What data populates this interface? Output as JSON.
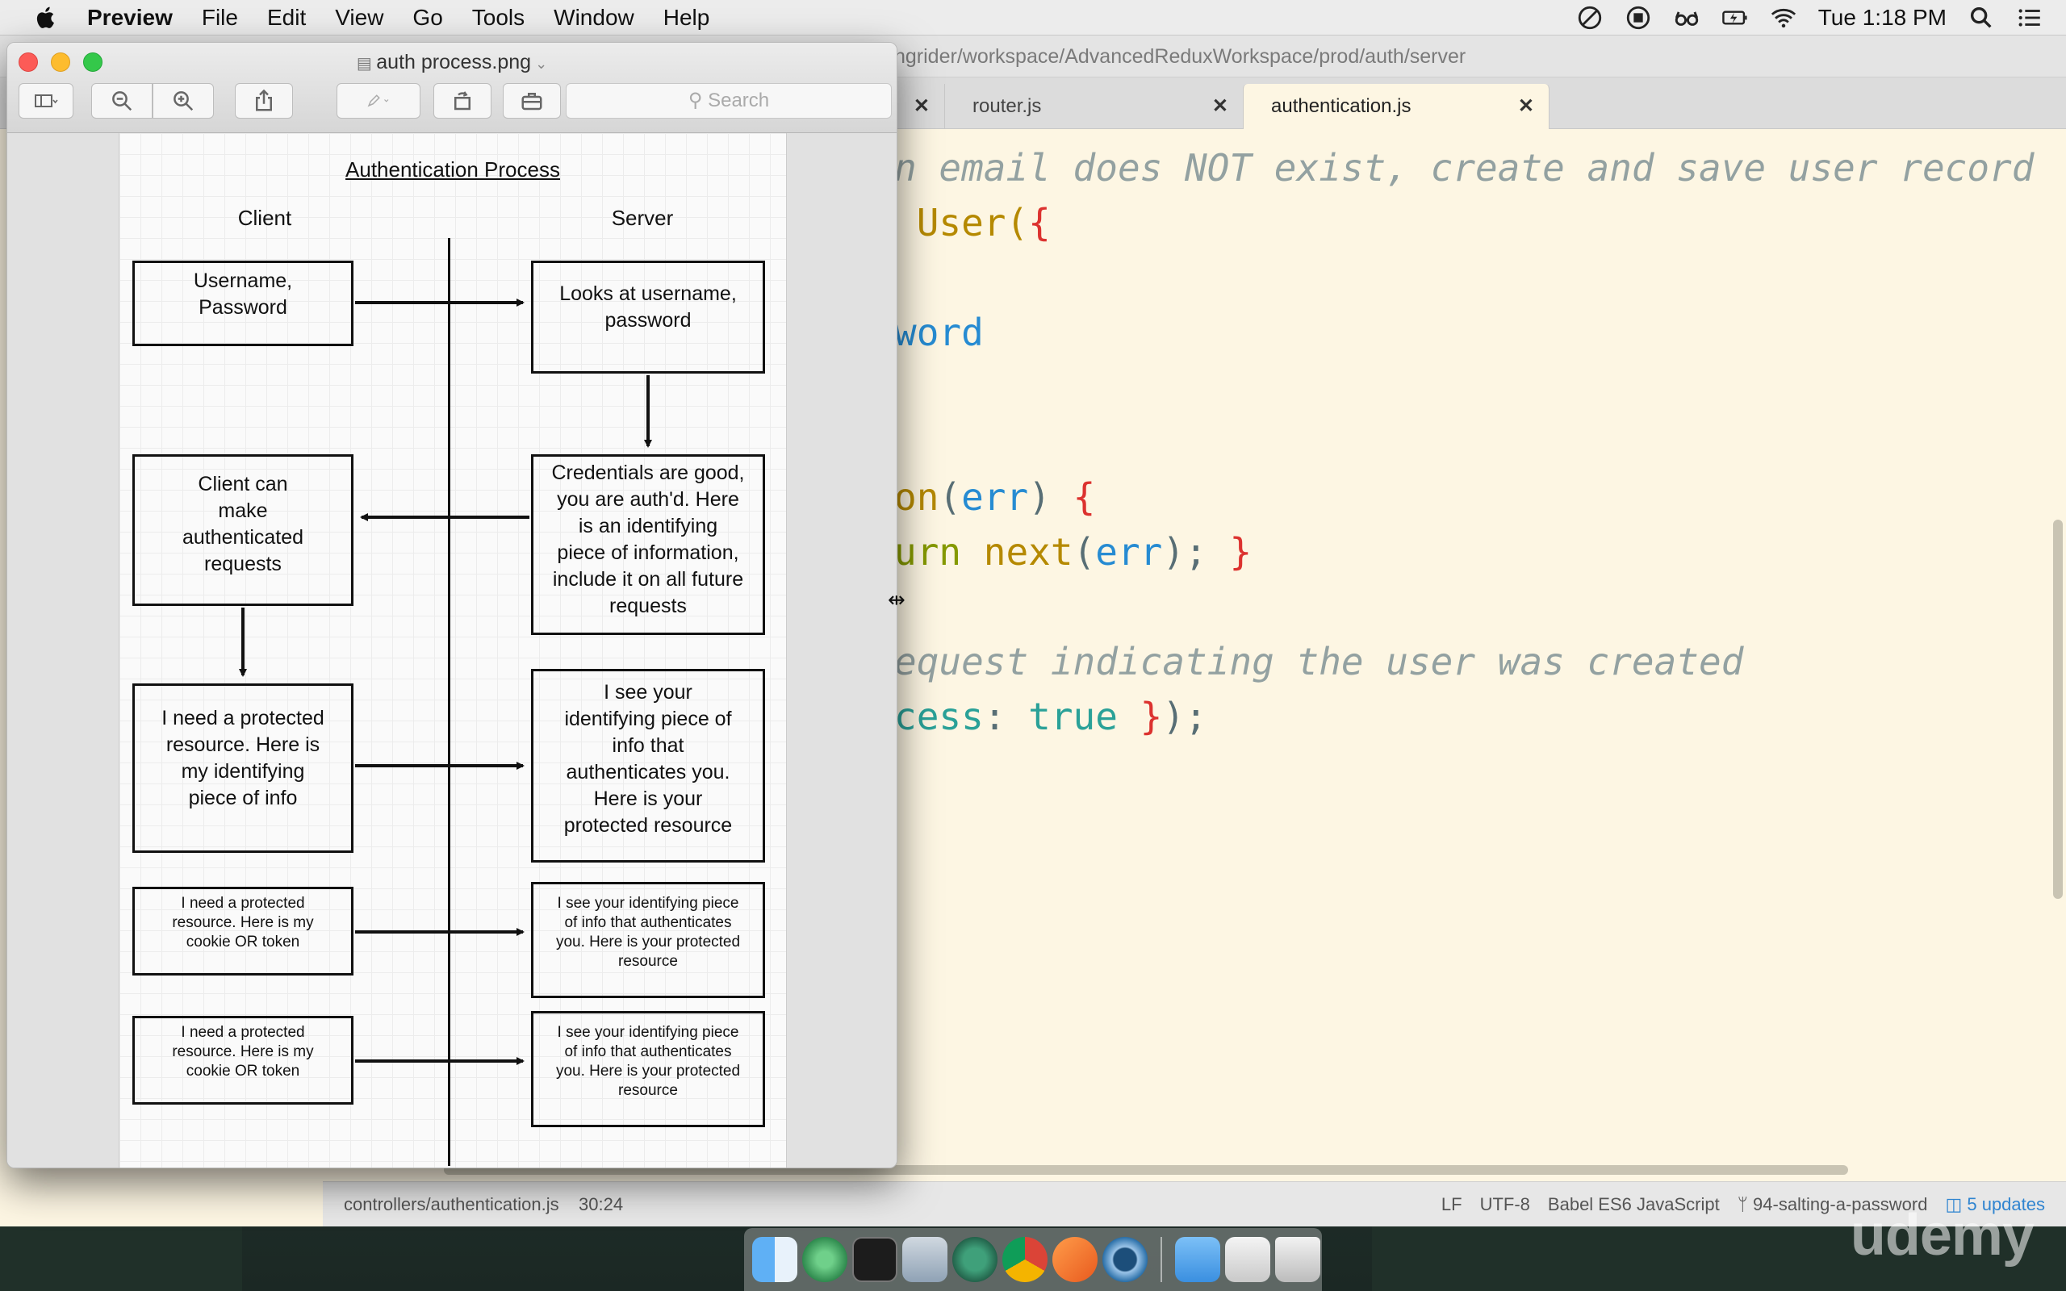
{
  "menubar": {
    "app_name": "Preview",
    "items": [
      "File",
      "Edit",
      "View",
      "Go",
      "Tools",
      "Window",
      "Help"
    ],
    "clock": "Tue 1:18 PM"
  },
  "editor": {
    "path": "ngrider/workspace/AdvancedReduxWorkspace/prod/auth/server",
    "tabs": [
      {
        "label": ""
      },
      {
        "label": "router.js"
      },
      {
        "label": "authentication.js"
      }
    ],
    "code_lines": [
      [
        {
          "t": "n email does NOT exist, create and save user record",
          "c": "comment"
        }
      ],
      [
        {
          "t": " User(",
          "c": "yellow"
        },
        {
          "t": "{",
          "c": "red"
        }
      ],
      [],
      [
        {
          "t": "word",
          "c": "blue"
        }
      ],
      [],
      [],
      [
        {
          "t": "on",
          "c": "yellow"
        },
        {
          "t": "(",
          "c": "grey"
        },
        {
          "t": "err",
          "c": "blue"
        },
        {
          "t": ") ",
          "c": "grey"
        },
        {
          "t": "{",
          "c": "red"
        }
      ],
      [
        {
          "t": "urn ",
          "c": "green"
        },
        {
          "t": "next",
          "c": "yellow"
        },
        {
          "t": "(",
          "c": "grey"
        },
        {
          "t": "err",
          "c": "blue"
        },
        {
          "t": "); ",
          "c": "grey"
        },
        {
          "t": "}",
          "c": "red"
        }
      ],
      [],
      [
        {
          "t": "equest indicating the user was created",
          "c": "comment"
        }
      ],
      [
        {
          "t": "cess",
          "c": "cyan"
        },
        {
          "t": ": ",
          "c": "grey"
        },
        {
          "t": "true",
          "c": "cyan"
        },
        {
          "t": " }",
          "c": "red"
        },
        {
          "t": ");",
          "c": "grey"
        }
      ]
    ],
    "status": {
      "file": "controllers/authentication.js",
      "cursor": "30:24",
      "line_ending": "LF",
      "encoding": "UTF-8",
      "grammar": "Babel ES6 JavaScript",
      "branch": "94-salting-a-password",
      "updates": "5 updates"
    }
  },
  "preview": {
    "title": "auth process.png",
    "search_placeholder": "Search",
    "diagram": {
      "title": "Authentication Process",
      "client_label": "Client",
      "server_label": "Server",
      "boxes": {
        "c1": "Username,\nPassword",
        "s1": "Looks at username,\npassword",
        "s2": "Credentials are good,\nyou are auth'd.  Here\nis an identifying\npiece of information,\ninclude it on all future\nrequests",
        "c2": "Client can\nmake\nauthenticated\nrequests",
        "c3": "I need a protected\nresource.  Here is\nmy identifying\npiece of info",
        "s3": "I see your\nidentifying piece of\ninfo that\nauthenticates you.\nHere is your\nprotected resource",
        "c4": "I need a protected\nresource.  Here is my\ncookie OR token",
        "s4": "I see your identifying piece\nof info that authenticates\nyou.  Here is your protected\nresource",
        "c5": "I need a protected\nresource.  Here is my\ncookie OR token",
        "s5": "I see your identifying piece\nof info that authenticates\nyou.  Here is your protected\nresource"
      }
    }
  },
  "watermark": "udemy"
}
